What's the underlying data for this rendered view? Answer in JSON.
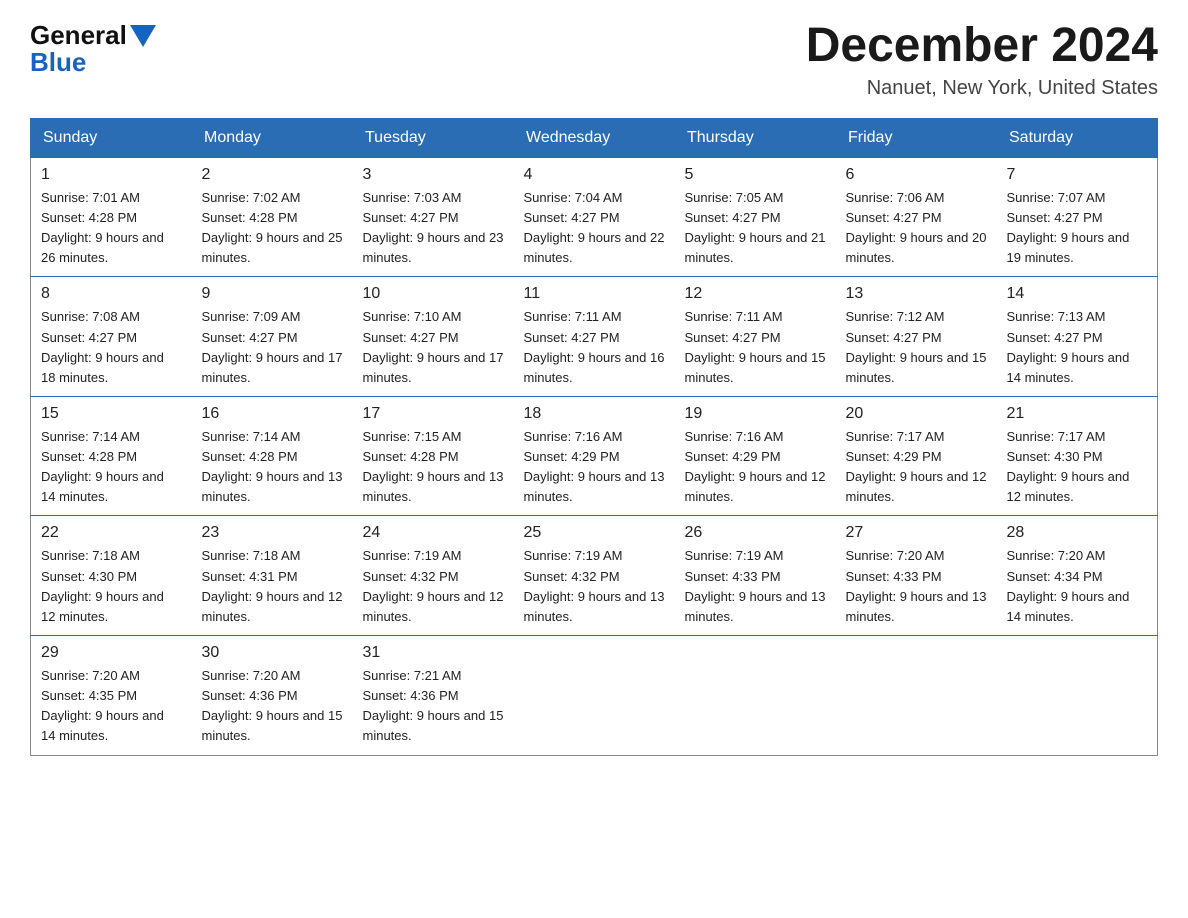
{
  "header": {
    "logo_general": "General",
    "logo_blue": "Blue",
    "title": "December 2024",
    "subtitle": "Nanuet, New York, United States"
  },
  "days_of_week": [
    "Sunday",
    "Monday",
    "Tuesday",
    "Wednesday",
    "Thursday",
    "Friday",
    "Saturday"
  ],
  "weeks": [
    [
      {
        "day": "1",
        "sunrise": "Sunrise: 7:01 AM",
        "sunset": "Sunset: 4:28 PM",
        "daylight": "Daylight: 9 hours and 26 minutes."
      },
      {
        "day": "2",
        "sunrise": "Sunrise: 7:02 AM",
        "sunset": "Sunset: 4:28 PM",
        "daylight": "Daylight: 9 hours and 25 minutes."
      },
      {
        "day": "3",
        "sunrise": "Sunrise: 7:03 AM",
        "sunset": "Sunset: 4:27 PM",
        "daylight": "Daylight: 9 hours and 23 minutes."
      },
      {
        "day": "4",
        "sunrise": "Sunrise: 7:04 AM",
        "sunset": "Sunset: 4:27 PM",
        "daylight": "Daylight: 9 hours and 22 minutes."
      },
      {
        "day": "5",
        "sunrise": "Sunrise: 7:05 AM",
        "sunset": "Sunset: 4:27 PM",
        "daylight": "Daylight: 9 hours and 21 minutes."
      },
      {
        "day": "6",
        "sunrise": "Sunrise: 7:06 AM",
        "sunset": "Sunset: 4:27 PM",
        "daylight": "Daylight: 9 hours and 20 minutes."
      },
      {
        "day": "7",
        "sunrise": "Sunrise: 7:07 AM",
        "sunset": "Sunset: 4:27 PM",
        "daylight": "Daylight: 9 hours and 19 minutes."
      }
    ],
    [
      {
        "day": "8",
        "sunrise": "Sunrise: 7:08 AM",
        "sunset": "Sunset: 4:27 PM",
        "daylight": "Daylight: 9 hours and 18 minutes."
      },
      {
        "day": "9",
        "sunrise": "Sunrise: 7:09 AM",
        "sunset": "Sunset: 4:27 PM",
        "daylight": "Daylight: 9 hours and 17 minutes."
      },
      {
        "day": "10",
        "sunrise": "Sunrise: 7:10 AM",
        "sunset": "Sunset: 4:27 PM",
        "daylight": "Daylight: 9 hours and 17 minutes."
      },
      {
        "day": "11",
        "sunrise": "Sunrise: 7:11 AM",
        "sunset": "Sunset: 4:27 PM",
        "daylight": "Daylight: 9 hours and 16 minutes."
      },
      {
        "day": "12",
        "sunrise": "Sunrise: 7:11 AM",
        "sunset": "Sunset: 4:27 PM",
        "daylight": "Daylight: 9 hours and 15 minutes."
      },
      {
        "day": "13",
        "sunrise": "Sunrise: 7:12 AM",
        "sunset": "Sunset: 4:27 PM",
        "daylight": "Daylight: 9 hours and 15 minutes."
      },
      {
        "day": "14",
        "sunrise": "Sunrise: 7:13 AM",
        "sunset": "Sunset: 4:27 PM",
        "daylight": "Daylight: 9 hours and 14 minutes."
      }
    ],
    [
      {
        "day": "15",
        "sunrise": "Sunrise: 7:14 AM",
        "sunset": "Sunset: 4:28 PM",
        "daylight": "Daylight: 9 hours and 14 minutes."
      },
      {
        "day": "16",
        "sunrise": "Sunrise: 7:14 AM",
        "sunset": "Sunset: 4:28 PM",
        "daylight": "Daylight: 9 hours and 13 minutes."
      },
      {
        "day": "17",
        "sunrise": "Sunrise: 7:15 AM",
        "sunset": "Sunset: 4:28 PM",
        "daylight": "Daylight: 9 hours and 13 minutes."
      },
      {
        "day": "18",
        "sunrise": "Sunrise: 7:16 AM",
        "sunset": "Sunset: 4:29 PM",
        "daylight": "Daylight: 9 hours and 13 minutes."
      },
      {
        "day": "19",
        "sunrise": "Sunrise: 7:16 AM",
        "sunset": "Sunset: 4:29 PM",
        "daylight": "Daylight: 9 hours and 12 minutes."
      },
      {
        "day": "20",
        "sunrise": "Sunrise: 7:17 AM",
        "sunset": "Sunset: 4:29 PM",
        "daylight": "Daylight: 9 hours and 12 minutes."
      },
      {
        "day": "21",
        "sunrise": "Sunrise: 7:17 AM",
        "sunset": "Sunset: 4:30 PM",
        "daylight": "Daylight: 9 hours and 12 minutes."
      }
    ],
    [
      {
        "day": "22",
        "sunrise": "Sunrise: 7:18 AM",
        "sunset": "Sunset: 4:30 PM",
        "daylight": "Daylight: 9 hours and 12 minutes."
      },
      {
        "day": "23",
        "sunrise": "Sunrise: 7:18 AM",
        "sunset": "Sunset: 4:31 PM",
        "daylight": "Daylight: 9 hours and 12 minutes."
      },
      {
        "day": "24",
        "sunrise": "Sunrise: 7:19 AM",
        "sunset": "Sunset: 4:32 PM",
        "daylight": "Daylight: 9 hours and 12 minutes."
      },
      {
        "day": "25",
        "sunrise": "Sunrise: 7:19 AM",
        "sunset": "Sunset: 4:32 PM",
        "daylight": "Daylight: 9 hours and 13 minutes."
      },
      {
        "day": "26",
        "sunrise": "Sunrise: 7:19 AM",
        "sunset": "Sunset: 4:33 PM",
        "daylight": "Daylight: 9 hours and 13 minutes."
      },
      {
        "day": "27",
        "sunrise": "Sunrise: 7:20 AM",
        "sunset": "Sunset: 4:33 PM",
        "daylight": "Daylight: 9 hours and 13 minutes."
      },
      {
        "day": "28",
        "sunrise": "Sunrise: 7:20 AM",
        "sunset": "Sunset: 4:34 PM",
        "daylight": "Daylight: 9 hours and 14 minutes."
      }
    ],
    [
      {
        "day": "29",
        "sunrise": "Sunrise: 7:20 AM",
        "sunset": "Sunset: 4:35 PM",
        "daylight": "Daylight: 9 hours and 14 minutes."
      },
      {
        "day": "30",
        "sunrise": "Sunrise: 7:20 AM",
        "sunset": "Sunset: 4:36 PM",
        "daylight": "Daylight: 9 hours and 15 minutes."
      },
      {
        "day": "31",
        "sunrise": "Sunrise: 7:21 AM",
        "sunset": "Sunset: 4:36 PM",
        "daylight": "Daylight: 9 hours and 15 minutes."
      },
      null,
      null,
      null,
      null
    ]
  ]
}
